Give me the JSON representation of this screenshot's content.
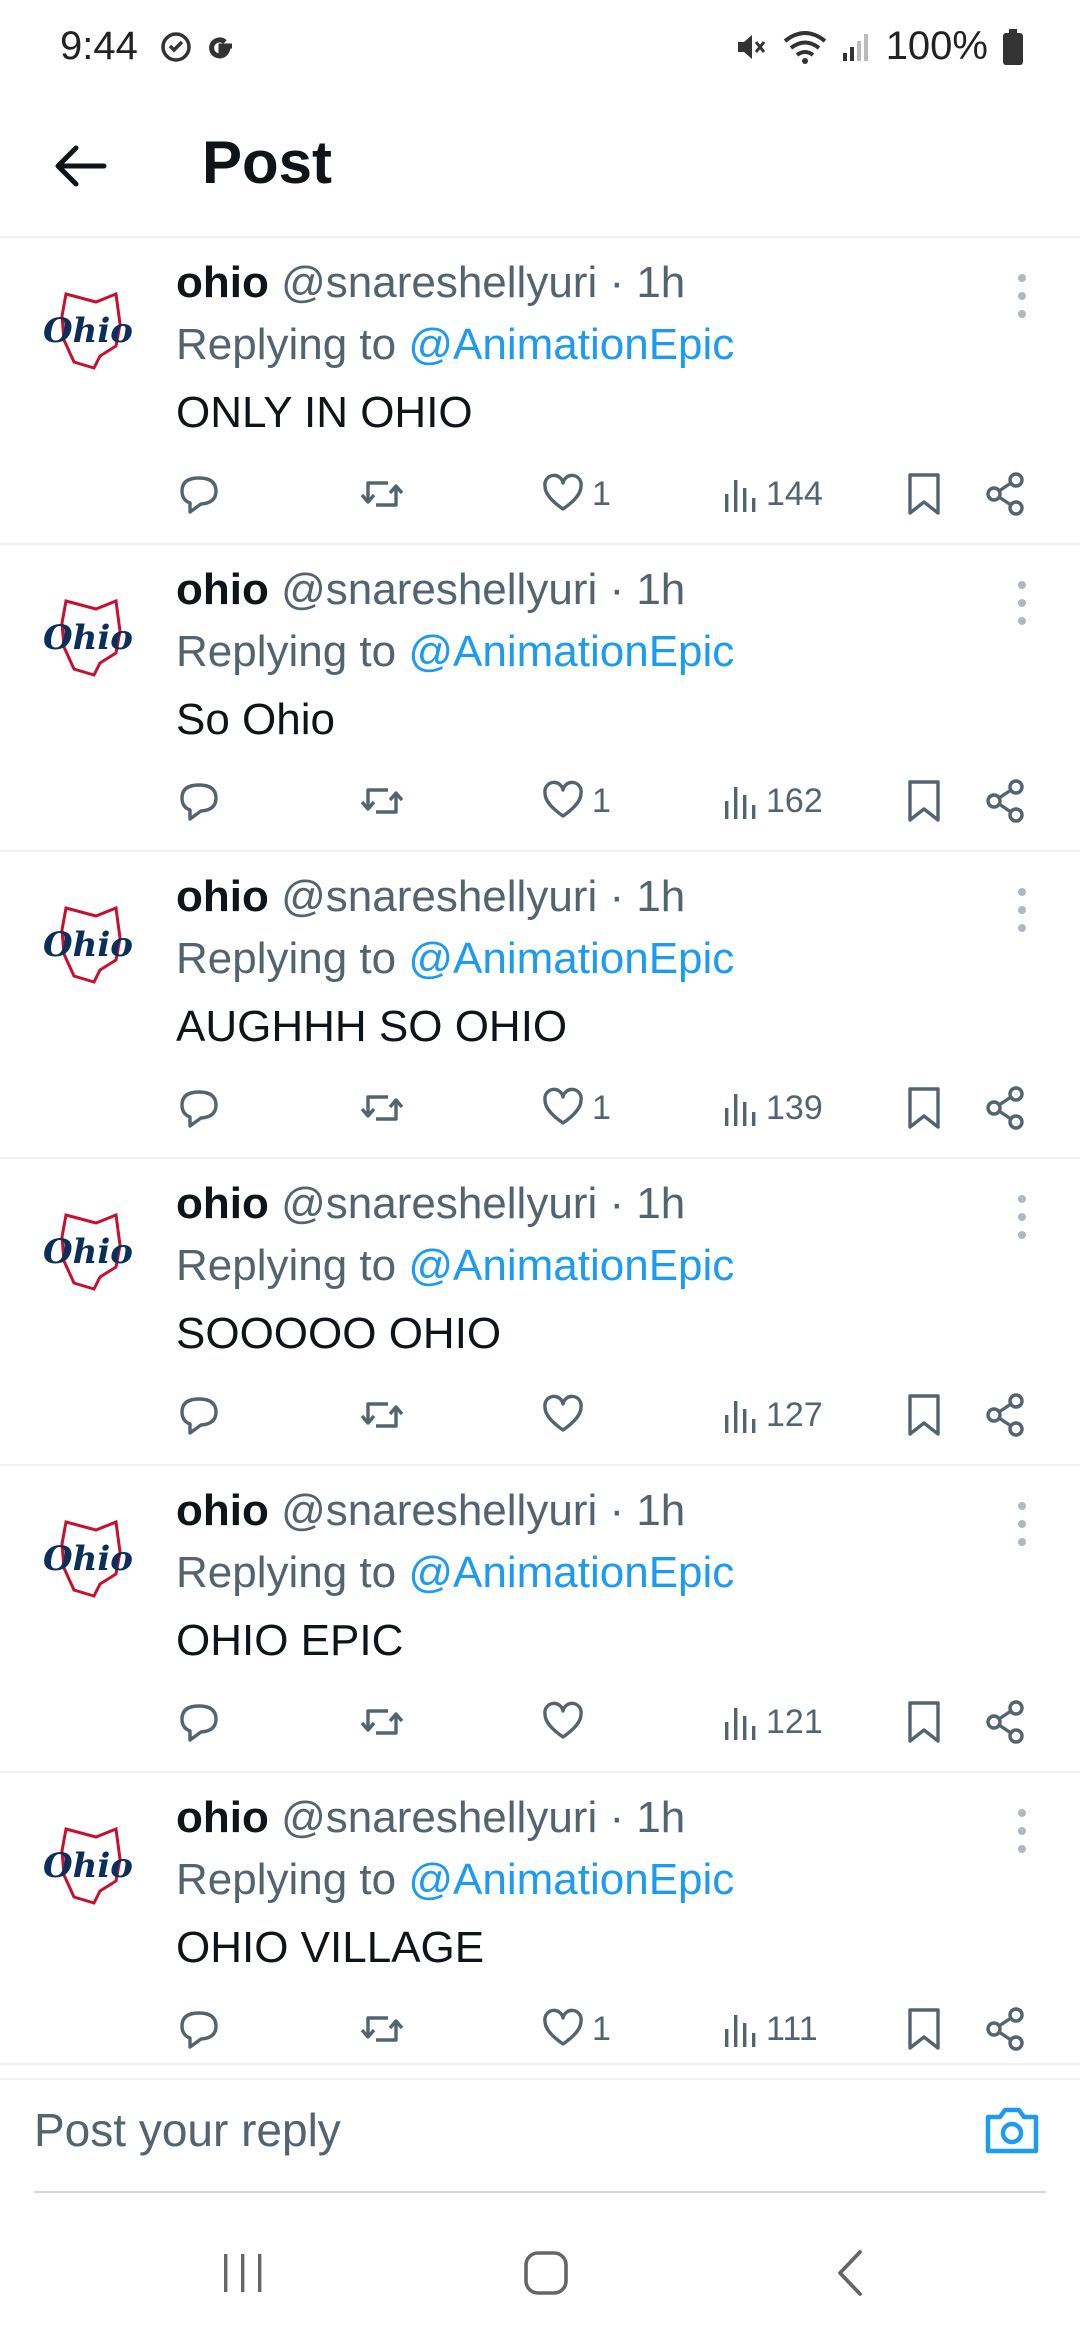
{
  "status_bar": {
    "time": "9:44",
    "battery": "100%"
  },
  "header": {
    "title": "Post"
  },
  "posts": [
    {
      "name": "ohio",
      "handle": "@snareshellyuri",
      "time": "· 1h",
      "replying_prefix": "Replying to",
      "replying_to": "@AnimationEpic",
      "text": "ONLY IN OHIO",
      "likes": "1",
      "views": "144"
    },
    {
      "name": "ohio",
      "handle": "@snareshellyuri",
      "time": "· 1h",
      "replying_prefix": "Replying to",
      "replying_to": "@AnimationEpic",
      "text": "So Ohio",
      "likes": "1",
      "views": "162"
    },
    {
      "name": "ohio",
      "handle": "@snareshellyuri",
      "time": "· 1h",
      "replying_prefix": "Replying to",
      "replying_to": "@AnimationEpic",
      "text": "AUGHHH SO OHIO",
      "likes": "1",
      "views": "139"
    },
    {
      "name": "ohio",
      "handle": "@snareshellyuri",
      "time": "· 1h",
      "replying_prefix": "Replying to",
      "replying_to": "@AnimationEpic",
      "text": "SOOOOO OHIO",
      "likes": "",
      "views": "127"
    },
    {
      "name": "ohio",
      "handle": "@snareshellyuri",
      "time": "· 1h",
      "replying_prefix": "Replying to",
      "replying_to": "@AnimationEpic",
      "text": "OHIO EPIC",
      "likes": "",
      "views": "121"
    },
    {
      "name": "ohio",
      "handle": "@snareshellyuri",
      "time": "· 1h",
      "replying_prefix": "Replying to",
      "replying_to": "@AnimationEpic",
      "text": "OHIO VILLAGE",
      "likes": "1",
      "views": "111"
    }
  ],
  "reply_bar": {
    "placeholder": "Post your reply"
  },
  "icons": {
    "avatar_logo_text": "Ohio",
    "reply": "reply-icon",
    "repost": "repost-icon",
    "like": "heart-icon",
    "views": "views-icon",
    "bookmark": "bookmark-icon",
    "share": "share-icon",
    "more": "more-vertical-icon",
    "camera": "camera-icon"
  },
  "colors": {
    "accent": "#1d9bf0",
    "text_primary": "#0f1419",
    "text_secondary": "#536471",
    "ohio_red": "#c8102e",
    "ohio_navy": "#0b2f5b"
  }
}
